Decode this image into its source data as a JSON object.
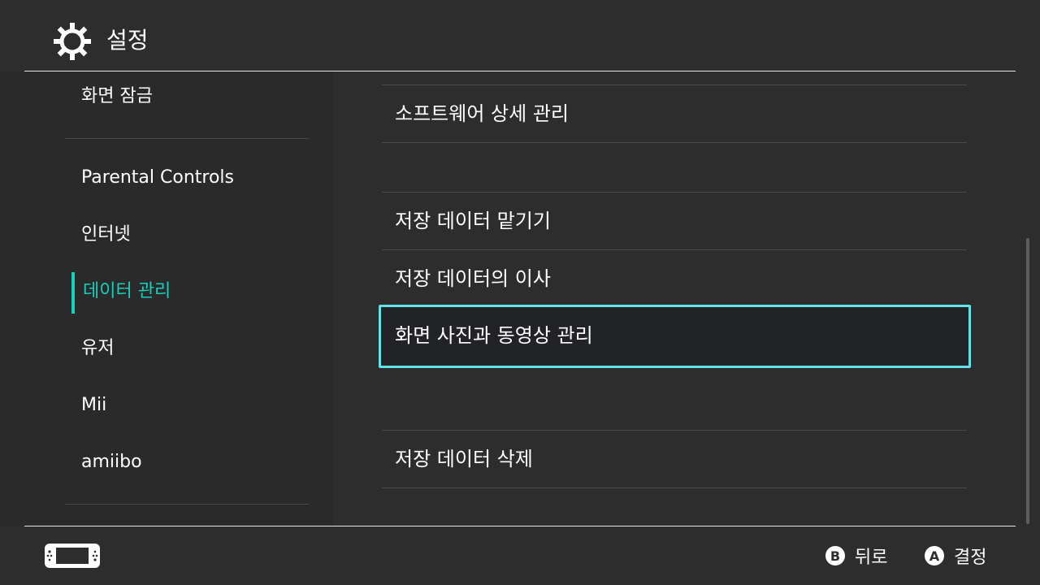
{
  "header": {
    "title": "설정",
    "icon": "gear-icon"
  },
  "sidebar": {
    "items": [
      {
        "label": "화면 잠금"
      },
      {
        "label": "Parental Controls"
      },
      {
        "label": "인터넷"
      },
      {
        "label": "데이터 관리",
        "active": true
      },
      {
        "label": "유저"
      },
      {
        "label": "Mii"
      },
      {
        "label": "amiibo"
      }
    ]
  },
  "main": {
    "items": [
      {
        "label": "소프트웨어 상세 관리"
      },
      {
        "label": "저장 데이터 맡기기"
      },
      {
        "label": "저장 데이터의 이사"
      },
      {
        "label": "화면 사진과 동영상 관리",
        "focused": true
      },
      {
        "label": "저장 데이터 삭제"
      }
    ]
  },
  "footer": {
    "console_icon": "switch-console-icon",
    "back": {
      "button": "B",
      "label": "뒤로"
    },
    "confirm": {
      "button": "A",
      "label": "결정"
    }
  },
  "colors": {
    "accent": "#14d2be",
    "focus": "#63e1e9",
    "background": "#2d2d2d"
  }
}
